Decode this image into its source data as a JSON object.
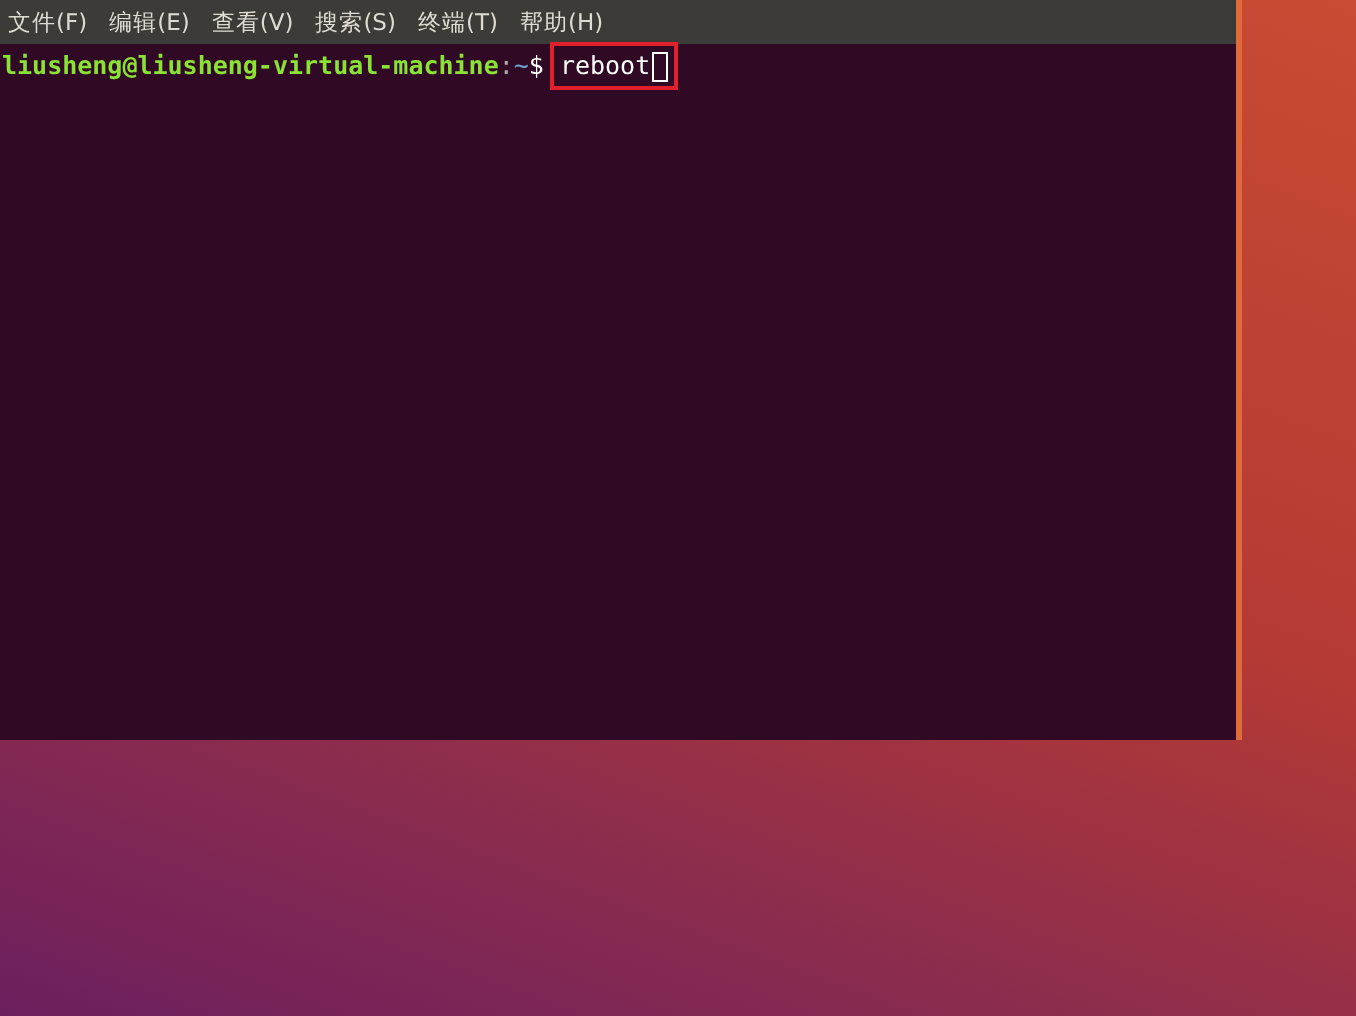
{
  "menu": [
    {
      "label": "文件(F)"
    },
    {
      "label": "编辑(E)"
    },
    {
      "label": "查看(V)"
    },
    {
      "label": "搜索(S)"
    },
    {
      "label": "终端(T)"
    },
    {
      "label": "帮助(H)"
    }
  ],
  "prompt": {
    "user_host": "liusheng@liusheng-virtual-machine",
    "separator": ":",
    "path": "~",
    "symbol": "$",
    "command": "reboot",
    "highlighted": true,
    "cursor": true
  }
}
